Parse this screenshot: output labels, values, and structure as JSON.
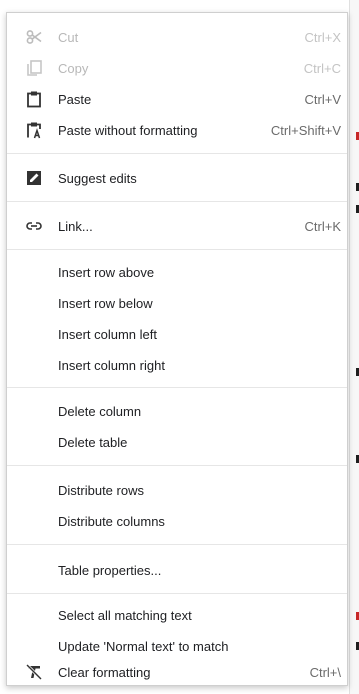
{
  "menu": {
    "items": [
      {
        "label": "Cut",
        "shortcut": "Ctrl+X",
        "icon": "scissors-icon",
        "enabled": false
      },
      {
        "label": "Copy",
        "shortcut": "Ctrl+C",
        "icon": "copy-icon",
        "enabled": false
      },
      {
        "label": "Paste",
        "shortcut": "Ctrl+V",
        "icon": "paste-icon",
        "enabled": true
      },
      {
        "label": "Paste without formatting",
        "shortcut": "Ctrl+Shift+V",
        "icon": "paste-plain-icon",
        "enabled": true
      },
      {
        "label": "Suggest edits",
        "shortcut": "",
        "icon": "suggest-edits-icon",
        "enabled": true
      },
      {
        "label": "Link...",
        "shortcut": "Ctrl+K",
        "icon": "link-icon",
        "enabled": true
      },
      {
        "label": "Insert row above",
        "shortcut": "",
        "icon": "",
        "enabled": true
      },
      {
        "label": "Insert row below",
        "shortcut": "",
        "icon": "",
        "enabled": true
      },
      {
        "label": "Insert column left",
        "shortcut": "",
        "icon": "",
        "enabled": true
      },
      {
        "label": "Insert column right",
        "shortcut": "",
        "icon": "",
        "enabled": true
      },
      {
        "label": "Delete column",
        "shortcut": "",
        "icon": "",
        "enabled": true
      },
      {
        "label": "Delete table",
        "shortcut": "",
        "icon": "",
        "enabled": true
      },
      {
        "label": "Distribute rows",
        "shortcut": "",
        "icon": "",
        "enabled": true
      },
      {
        "label": "Distribute columns",
        "shortcut": "",
        "icon": "",
        "enabled": true
      },
      {
        "label": "Table properties...",
        "shortcut": "",
        "icon": "",
        "enabled": true
      },
      {
        "label": "Select all matching text",
        "shortcut": "",
        "icon": "",
        "enabled": true
      },
      {
        "label": "Update 'Normal text' to match",
        "shortcut": "",
        "icon": "",
        "enabled": true
      },
      {
        "label": "Clear formatting",
        "shortcut": "Ctrl+\\",
        "icon": "clear-formatting-icon",
        "enabled": true
      }
    ]
  },
  "colors": {
    "text": "#202124",
    "disabled_text": "#b8b8b8",
    "shortcut_text": "#6b6b6b",
    "icon": "#3c3c3c",
    "separator": "#e6e6e6"
  }
}
